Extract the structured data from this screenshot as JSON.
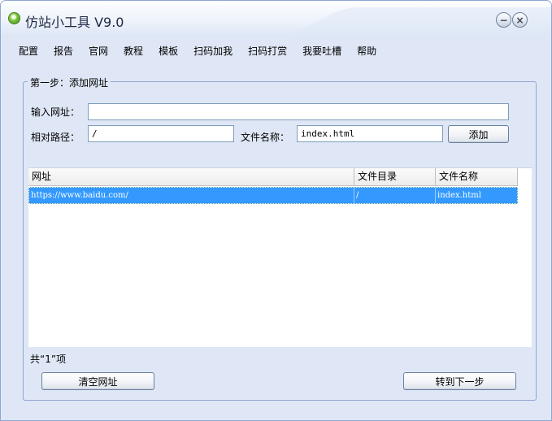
{
  "window": {
    "title": "仿站小工具 V9.0",
    "minimize_glyph": "−",
    "close_glyph": "×"
  },
  "menu": {
    "items": [
      "配置",
      "报告",
      "官网",
      "教程",
      "模板",
      "扫码加我",
      "扫码打赏",
      "我要吐槽",
      "帮助"
    ]
  },
  "step1": {
    "legend": "第一步：添加网址",
    "url_label": "输入网址：",
    "url_value": "",
    "path_label": "相对路径：",
    "path_value": "/",
    "filename_label": "文件名称：",
    "filename_value": "index.html",
    "add_button": "添加"
  },
  "table": {
    "columns": [
      "网址",
      "文件目录",
      "文件名称"
    ],
    "rows": [
      {
        "url": "https://www.baidu.com/",
        "dir": "/",
        "file": "index.html",
        "selected": true
      }
    ]
  },
  "footer": {
    "count_text": "共“1”项",
    "clear_button": "清空网址",
    "next_button": "转到下一步"
  },
  "colors": {
    "window_bg": "#dfe7f6",
    "selection": "#3399ff",
    "border": "#8fa7cf"
  }
}
